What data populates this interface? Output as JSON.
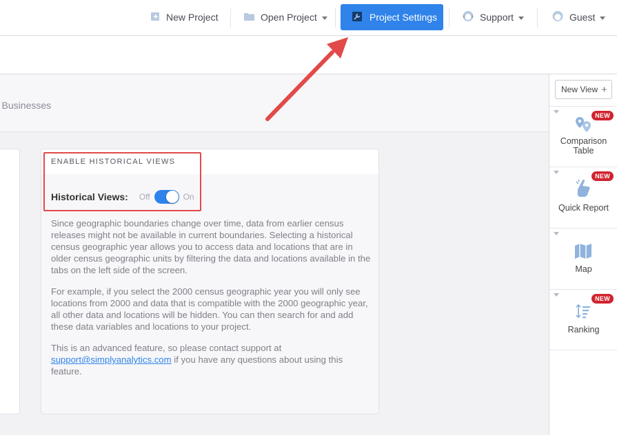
{
  "topbar": {
    "new_project": "New Project",
    "open_project": "Open Project",
    "project_settings": "Project Settings",
    "support": "Support",
    "guest": "Guest"
  },
  "panel": {
    "header_partial": "r Businesses"
  },
  "card": {
    "heading": "ENABLE HISTORICAL VIEWS",
    "toggle_label": "Historical Views:",
    "toggle_off": "Off",
    "toggle_on": "On",
    "toggle_state": "on",
    "para1": "Since geographic boundaries change over time, data from earlier census releases might not be available in current boundaries. Selecting a historical census geographic year allows you to access data and locations that are in older census geographic units by filtering the data and locations available in the tabs on the left side of the screen.",
    "para2": "For example, if you select the 2000 census geographic year you will only see locations from 2000 and data that is compatible with the 2000 geographic year, all other data and locations will be hidden. You can then search for and add these data variables and locations to your project.",
    "para3_before": "This is an advanced feature, so please contact support at",
    "support_email": "support@simplyanalytics.com",
    "para3_after": "if you have any questions about using this feature."
  },
  "sidebar": {
    "new_view": "New View",
    "items": [
      {
        "label_line1": "Comparison",
        "label_line2": "Table",
        "badge": "NEW",
        "icon": "map-pins-icon"
      },
      {
        "label_line1": "Quick Report",
        "badge": "NEW",
        "icon": "pointing-hand-icon"
      },
      {
        "label_line1": "Map",
        "icon": "map-icon"
      },
      {
        "label_line1": "Ranking",
        "badge": "NEW",
        "icon": "ranking-icon"
      }
    ]
  },
  "colors": {
    "accent": "#2f83ea",
    "highlight_red": "#e24a4a",
    "badge_red": "#d0242f"
  }
}
